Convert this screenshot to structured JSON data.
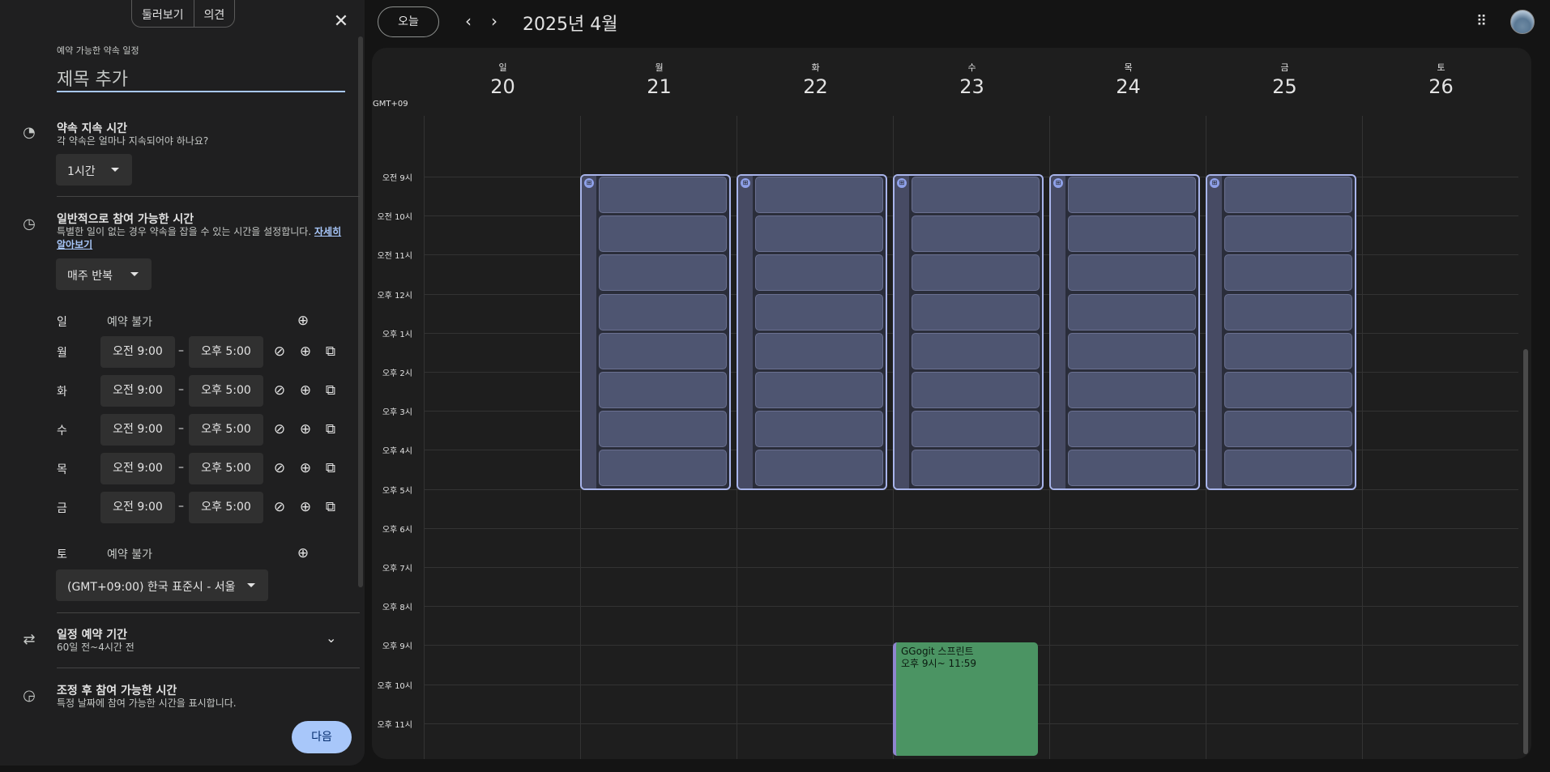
{
  "panel": {
    "tabs": [
      "둘러보기",
      "의견"
    ],
    "close_icon": "close-icon",
    "heading_label": "예약 가능한 약속 일정",
    "title_placeholder": "제목 추가",
    "duration": {
      "title": "약속 지속 시간",
      "subtitle": "각 약속은 얼마나 지속되어야 하나요?",
      "value": "1시간"
    },
    "availability": {
      "title": "일반적으로 참여 가능한 시간",
      "subtitle": "특별한 일이 없는 경우 약속을 잡을 수 있는 시간을 설정합니다.",
      "learn_more": "자세히 알아보기",
      "repeat": "매주 반복",
      "days": [
        {
          "day": "일",
          "unavailable": "예약 불가"
        },
        {
          "day": "월",
          "start": "오전 9:00",
          "end": "오후 5:00"
        },
        {
          "day": "화",
          "start": "오전 9:00",
          "end": "오후 5:00"
        },
        {
          "day": "수",
          "start": "오전 9:00",
          "end": "오후 5:00"
        },
        {
          "day": "목",
          "start": "오전 9:00",
          "end": "오후 5:00"
        },
        {
          "day": "금",
          "start": "오전 9:00",
          "end": "오후 5:00"
        },
        {
          "day": "토",
          "unavailable": "예약 불가"
        }
      ],
      "dash": "–",
      "timezone": "(GMT+09:00) 한국 표준시 - 서울"
    },
    "booking_window": {
      "title": "일정 예약 기간",
      "subtitle": "60일 전~4시간 전"
    },
    "adjusted": {
      "title": "조정 후 참여 가능한 시간",
      "subtitle": "특정 날짜에 참여 가능한 시간을 표시합니다."
    },
    "next_label": "다음"
  },
  "header": {
    "today_label": "오늘",
    "prev_icon": "chevron-left-icon",
    "next_icon": "chevron-right-icon",
    "month": "2025년 4월",
    "apps_icon": "apps-grid-icon"
  },
  "calendar": {
    "timezone_label": "GMT+09",
    "days": [
      {
        "name": "일",
        "num": "20"
      },
      {
        "name": "월",
        "num": "21"
      },
      {
        "name": "화",
        "num": "22"
      },
      {
        "name": "수",
        "num": "23"
      },
      {
        "name": "목",
        "num": "24"
      },
      {
        "name": "금",
        "num": "25"
      },
      {
        "name": "토",
        "num": "26"
      }
    ],
    "hours": [
      "오전 9시",
      "오전 10시",
      "오전 11시",
      "오후 12시",
      "오후 1시",
      "오후 2시",
      "오후 3시",
      "오후 4시",
      "오후 5시",
      "오후 6시",
      "오후 7시",
      "오후 8시",
      "오후 9시",
      "오후 10시",
      "오후 11시"
    ],
    "event": {
      "title": "GGogit 스프린트",
      "time": "오후 9시~ 11:59",
      "color": "#4b9463"
    }
  }
}
